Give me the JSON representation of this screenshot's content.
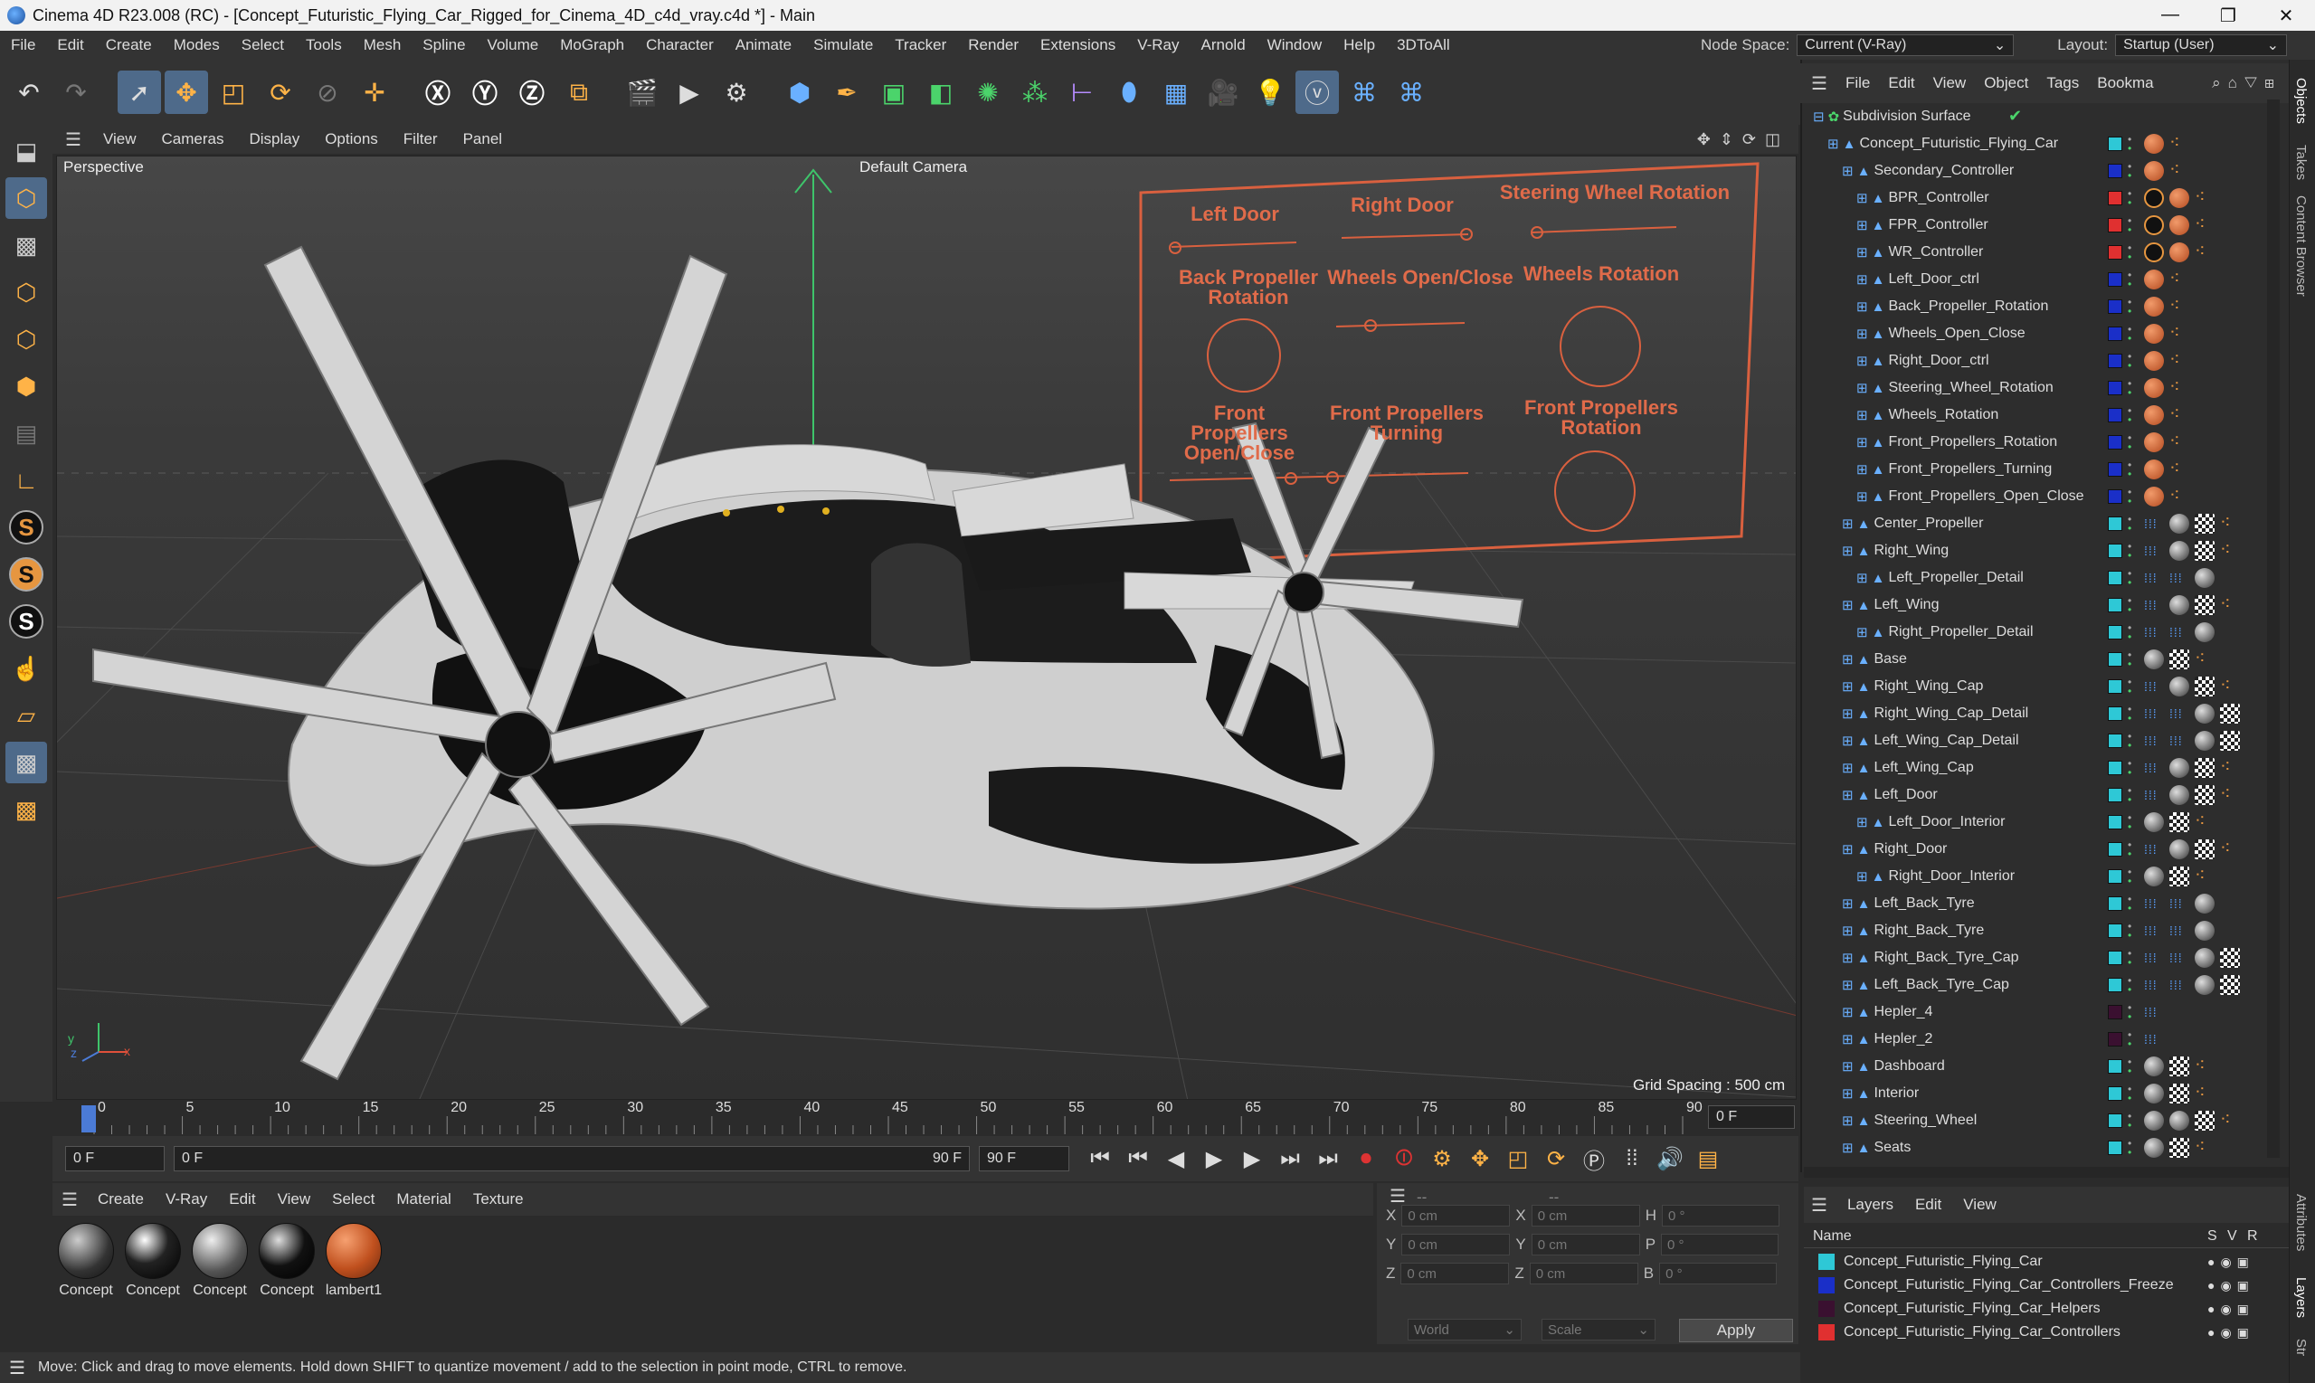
{
  "title": "Cinema 4D R23.008 (RC) - [Concept_Futuristic_Flying_Car_Rigged_for_Cinema_4D_c4d_vray.c4d *] - Main",
  "menu": [
    "File",
    "Edit",
    "Create",
    "Modes",
    "Select",
    "Tools",
    "Mesh",
    "Spline",
    "Volume",
    "MoGraph",
    "Character",
    "Animate",
    "Simulate",
    "Tracker",
    "Render",
    "Extensions",
    "V-Ray",
    "Arnold",
    "Window",
    "Help",
    "3DToAll"
  ],
  "node_space": {
    "label": "Node Space:",
    "value": "Current (V-Ray)"
  },
  "layout": {
    "label": "Layout:",
    "value": "Startup (User)"
  },
  "viewport": {
    "menu": [
      "View",
      "Cameras",
      "Display",
      "Options",
      "Filter",
      "Panel"
    ],
    "projection": "Perspective",
    "camera": "Default Camera",
    "grid_spacing": "Grid Spacing : 500 cm"
  },
  "controllers": {
    "left_door": "Left Door",
    "right_door": "Right Door",
    "steering": "Steering Wheel Rotation",
    "back_prop": "Back Propeller Rotation",
    "wheels_open": "Wheels Open/Close",
    "wheels_rot": "Wheels Rotation",
    "front_open": "Front Propellers Open/Close",
    "front_turn": "Front Propellers Turning",
    "front_rot": "Front Propellers Rotation"
  },
  "timeline": {
    "ticks": [
      "0",
      "5",
      "10",
      "15",
      "20",
      "25",
      "30",
      "35",
      "40",
      "45",
      "50",
      "55",
      "60",
      "65",
      "70",
      "75",
      "80",
      "85",
      "90"
    ],
    "current": "0 F",
    "start": "0 F",
    "range_start": "0 F",
    "range_end": "90 F",
    "end": "90 F",
    "frame_field": "0 F"
  },
  "material": {
    "menu": [
      "Create",
      "V-Ray",
      "Edit",
      "View",
      "Select",
      "Material",
      "Texture"
    ],
    "items": [
      "Concept",
      "Concept",
      "Concept",
      "Concept",
      "lambert1"
    ]
  },
  "coords": {
    "x": "X",
    "y": "Y",
    "z": "Z",
    "h": "H",
    "p": "P",
    "b": "B",
    "pos_x": "0 cm",
    "pos_y": "0 cm",
    "pos_z": "0 cm",
    "size_x": "0 cm",
    "size_y": "0 cm",
    "size_z": "0 cm",
    "rot_h": "0 °",
    "rot_p": "0 °",
    "rot_b": "0 °",
    "mode": "World",
    "mode2": "Scale",
    "apply": "Apply",
    "dash1": "--",
    "dash2": "--"
  },
  "status": "Move: Click and drag to move elements. Hold down SHIFT to quantize movement / add to the selection in point mode, CTRL to remove.",
  "objects": {
    "menu": [
      "File",
      "Edit",
      "View",
      "Object",
      "Tags",
      "Bookma"
    ],
    "rows": [
      {
        "name": "Subdivision Surface",
        "indent": 0,
        "color": "",
        "tags": [
          "check"
        ]
      },
      {
        "name": "Concept_Futuristic_Flying_Car",
        "indent": 1,
        "color": "#2ec8d6",
        "tags": [
          "mat",
          "dots"
        ]
      },
      {
        "name": "Secondary_Controller",
        "indent": 2,
        "color": "#1a2fc8",
        "tags": [
          "mat",
          "dots"
        ]
      },
      {
        "name": "BPR_Controller",
        "indent": 3,
        "color": "#e03030",
        "tags": [
          "no",
          "mat",
          "dots"
        ]
      },
      {
        "name": "FPR_Controller",
        "indent": 3,
        "color": "#e03030",
        "tags": [
          "no",
          "mat",
          "dots"
        ]
      },
      {
        "name": "WR_Controller",
        "indent": 3,
        "color": "#e03030",
        "tags": [
          "no",
          "mat",
          "dots"
        ]
      },
      {
        "name": "Left_Door_ctrl",
        "indent": 3,
        "color": "#1a2fc8",
        "tags": [
          "mat",
          "dots"
        ]
      },
      {
        "name": "Back_Propeller_Rotation",
        "indent": 3,
        "color": "#1a2fc8",
        "tags": [
          "mat",
          "dots"
        ]
      },
      {
        "name": "Wheels_Open_Close",
        "indent": 3,
        "color": "#1a2fc8",
        "tags": [
          "mat",
          "dots"
        ]
      },
      {
        "name": "Right_Door_ctrl",
        "indent": 3,
        "color": "#1a2fc8",
        "tags": [
          "mat",
          "dots"
        ]
      },
      {
        "name": "Steering_Wheel_Rotation",
        "indent": 3,
        "color": "#1a2fc8",
        "tags": [
          "mat",
          "dots"
        ]
      },
      {
        "name": "Wheels_Rotation",
        "indent": 3,
        "color": "#1a2fc8",
        "tags": [
          "mat",
          "dots"
        ]
      },
      {
        "name": "Front_Propellers_Rotation",
        "indent": 3,
        "color": "#1a2fc8",
        "tags": [
          "mat",
          "dots"
        ]
      },
      {
        "name": "Front_Propellers_Turning",
        "indent": 3,
        "color": "#1a2fc8",
        "tags": [
          "mat",
          "dots"
        ]
      },
      {
        "name": "Front_Propellers_Open_Close",
        "indent": 3,
        "color": "#1a2fc8",
        "tags": [
          "mat",
          "dots"
        ]
      },
      {
        "name": "Center_Propeller",
        "indent": 2,
        "color": "#2ec8d6",
        "tags": [
          "blue",
          "grey",
          "chk",
          "dots"
        ]
      },
      {
        "name": "Right_Wing",
        "indent": 2,
        "color": "#2ec8d6",
        "tags": [
          "blue",
          "grey",
          "chk",
          "dots"
        ]
      },
      {
        "name": "Left_Propeller_Detail",
        "indent": 3,
        "color": "#2ec8d6",
        "tags": [
          "blue",
          "blue",
          "grey"
        ]
      },
      {
        "name": "Left_Wing",
        "indent": 2,
        "color": "#2ec8d6",
        "tags": [
          "blue",
          "grey",
          "chk",
          "dots"
        ]
      },
      {
        "name": "Right_Propeller_Detail",
        "indent": 3,
        "color": "#2ec8d6",
        "tags": [
          "blue",
          "blue",
          "grey"
        ]
      },
      {
        "name": "Base",
        "indent": 2,
        "color": "#2ec8d6",
        "tags": [
          "grey",
          "chk",
          "dots"
        ]
      },
      {
        "name": "Right_Wing_Cap",
        "indent": 2,
        "color": "#2ec8d6",
        "tags": [
          "blue",
          "grey",
          "chk",
          "dots"
        ]
      },
      {
        "name": "Right_Wing_Cap_Detail",
        "indent": 2,
        "color": "#2ec8d6",
        "tags": [
          "blue",
          "blue",
          "grey",
          "chk"
        ]
      },
      {
        "name": "Left_Wing_Cap_Detail",
        "indent": 2,
        "color": "#2ec8d6",
        "tags": [
          "blue",
          "blue",
          "grey",
          "chk"
        ]
      },
      {
        "name": "Left_Wing_Cap",
        "indent": 2,
        "color": "#2ec8d6",
        "tags": [
          "blue",
          "grey",
          "chk",
          "dots"
        ]
      },
      {
        "name": "Left_Door",
        "indent": 2,
        "color": "#2ec8d6",
        "tags": [
          "blue",
          "grey",
          "chk",
          "dots"
        ]
      },
      {
        "name": "Left_Door_Interior",
        "indent": 3,
        "color": "#2ec8d6",
        "tags": [
          "grey",
          "chk",
          "dots"
        ]
      },
      {
        "name": "Right_Door",
        "indent": 2,
        "color": "#2ec8d6",
        "tags": [
          "blue",
          "grey",
          "chk",
          "dots"
        ]
      },
      {
        "name": "Right_Door_Interior",
        "indent": 3,
        "color": "#2ec8d6",
        "tags": [
          "grey",
          "chk",
          "dots"
        ]
      },
      {
        "name": "Left_Back_Tyre",
        "indent": 2,
        "color": "#2ec8d6",
        "tags": [
          "blue",
          "blue",
          "grey"
        ]
      },
      {
        "name": "Right_Back_Tyre",
        "indent": 2,
        "color": "#2ec8d6",
        "tags": [
          "blue",
          "blue",
          "grey"
        ]
      },
      {
        "name": "Right_Back_Tyre_Cap",
        "indent": 2,
        "color": "#2ec8d6",
        "tags": [
          "blue",
          "blue",
          "grey",
          "chk"
        ]
      },
      {
        "name": "Left_Back_Tyre_Cap",
        "indent": 2,
        "color": "#2ec8d6",
        "tags": [
          "blue",
          "blue",
          "grey",
          "chk"
        ]
      },
      {
        "name": "Hepler_4",
        "indent": 2,
        "color": "#3a1030",
        "tags": [
          "blue"
        ]
      },
      {
        "name": "Hepler_2",
        "indent": 2,
        "color": "#3a1030",
        "tags": [
          "blue"
        ]
      },
      {
        "name": "Dashboard",
        "indent": 2,
        "color": "#2ec8d6",
        "tags": [
          "grey",
          "chk",
          "dots"
        ]
      },
      {
        "name": "Interior",
        "indent": 2,
        "color": "#2ec8d6",
        "tags": [
          "grey",
          "chk",
          "dots"
        ]
      },
      {
        "name": "Steering_Wheel",
        "indent": 2,
        "color": "#2ec8d6",
        "tags": [
          "grey",
          "grey",
          "chk",
          "dots"
        ]
      },
      {
        "name": "Seats",
        "indent": 2,
        "color": "#2ec8d6",
        "tags": [
          "grey",
          "chk",
          "dots"
        ]
      }
    ]
  },
  "layers": {
    "menu": [
      "Layers",
      "Edit",
      "View"
    ],
    "header": {
      "name": "Name",
      "s": "S",
      "v": "V",
      "r": "R"
    },
    "rows": [
      {
        "name": "Concept_Futuristic_Flying_Car",
        "color": "#2ec8d6"
      },
      {
        "name": "Concept_Futuristic_Flying_Car_Controllers_Freeze",
        "color": "#1a2fc8"
      },
      {
        "name": "Concept_Futuristic_Flying_Car_Helpers",
        "color": "#3a1030"
      },
      {
        "name": "Concept_Futuristic_Flying_Car_Controllers",
        "color": "#e03030"
      }
    ]
  },
  "right_tabs": [
    "Objects",
    "Takes",
    "Content Browser",
    "Attributes",
    "Layers",
    "Str"
  ]
}
